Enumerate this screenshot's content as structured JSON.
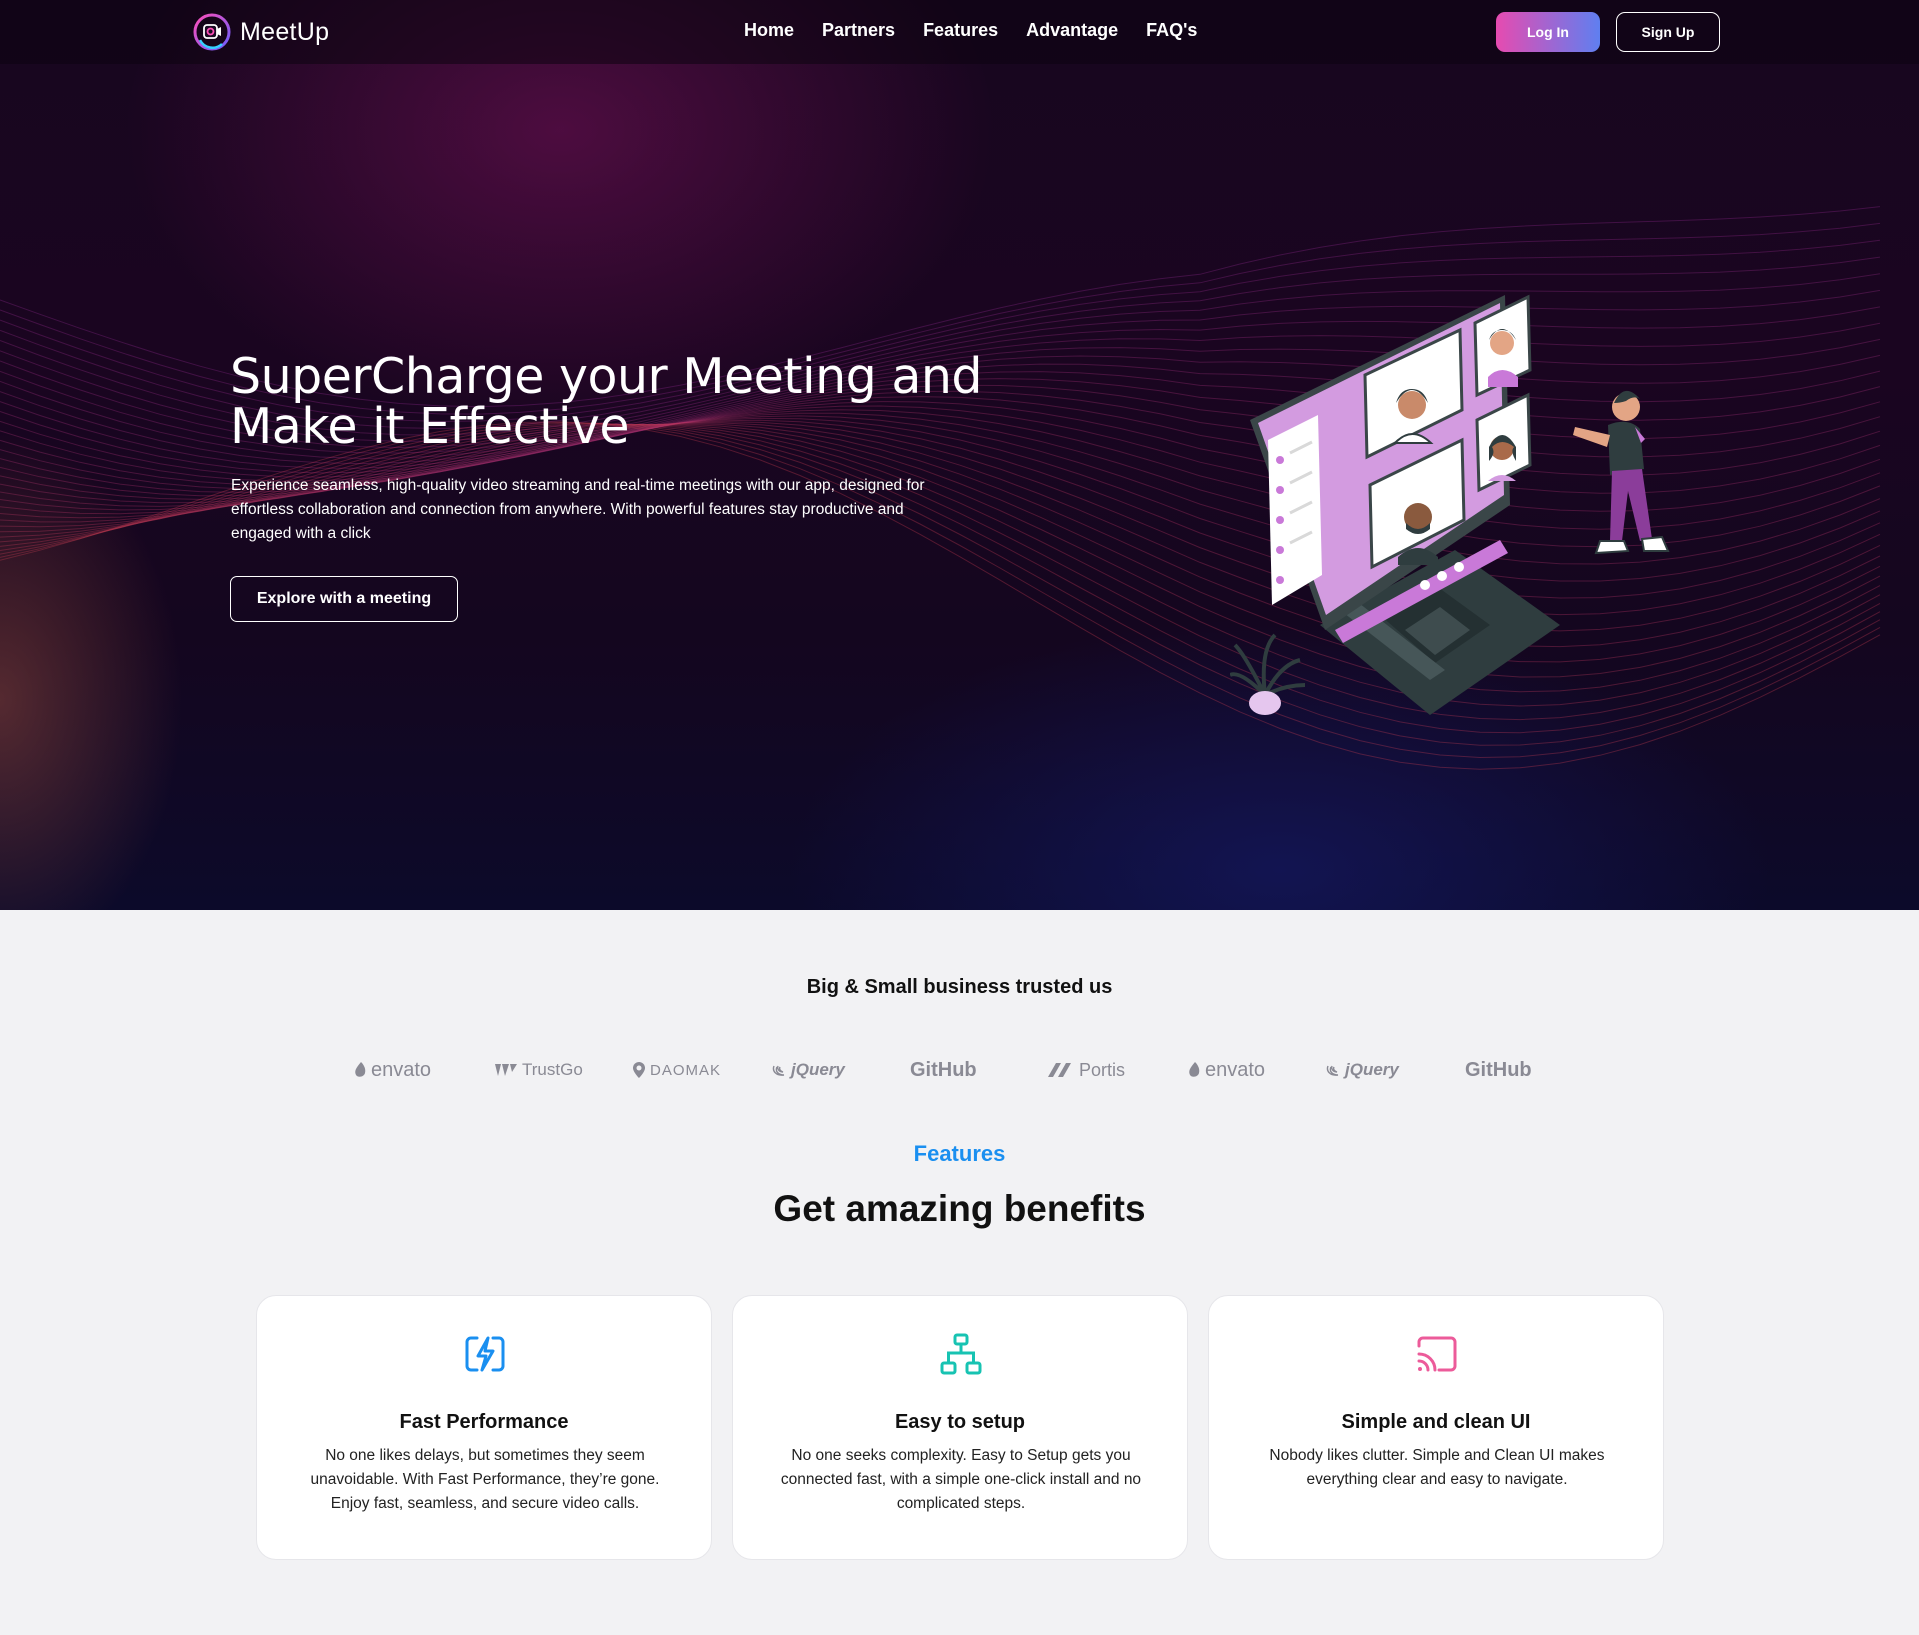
{
  "header": {
    "brand": "MeetUp",
    "nav": [
      {
        "label": "Home"
      },
      {
        "label": "Partners"
      },
      {
        "label": "Features"
      },
      {
        "label": "Advantage"
      },
      {
        "label": "FAQ's"
      }
    ],
    "login_label": "Log In",
    "signup_label": "Sign Up"
  },
  "hero": {
    "title": "SuperCharge your Meeting and Make it Effective",
    "description": "Experience seamless, high-quality video streaming and real-time meetings with our app, designed for effortless collaboration and connection from anywhere. With powerful features stay productive and engaged with a click",
    "cta_label": "Explore with a meeting"
  },
  "trusted": {
    "title": "Big & Small business trusted us",
    "brands": [
      {
        "name": "envato",
        "icon": "envato-leaf-icon"
      },
      {
        "name": "TrustGo",
        "icon": "trustgo-icon"
      },
      {
        "name": "DAOMAK",
        "icon": "map-pin-icon"
      },
      {
        "name": "jQuery",
        "icon": "jquery-icon"
      },
      {
        "name": "GitHub",
        "icon": ""
      },
      {
        "name": "Portis",
        "icon": "portis-icon"
      },
      {
        "name": "envato",
        "icon": "envato-leaf-icon"
      },
      {
        "name": "jQuery",
        "icon": "jquery-icon"
      },
      {
        "name": "GitHub",
        "icon": ""
      }
    ]
  },
  "features": {
    "eyebrow": "Features",
    "heading": "Get amazing benefits",
    "cards": [
      {
        "title": "Fast Performance",
        "description": "No one likes delays, but sometimes they seem unavoidable. With Fast Performance, they’re gone. Enjoy fast, seamless, and secure video calls.",
        "icon": "lightning-icon",
        "color": "#1a8ff0"
      },
      {
        "title": "Easy to setup",
        "description": "No one seeks complexity. Easy to Setup gets you connected fast, with a simple one-click install and no complicated steps.",
        "icon": "sitemap-icon",
        "color": "#17c3b2"
      },
      {
        "title": "Simple and clean UI",
        "description": "Nobody likes clutter. Simple and Clean UI makes everything clear and easy to navigate.",
        "icon": "cast-icon",
        "color": "#ec5b9a"
      }
    ]
  },
  "colors": {
    "accent_blue": "#1a8ff0",
    "login_gradient_start": "#e64bb0",
    "login_gradient_end": "#5f7ff0",
    "hero_bg": "#18061f",
    "page_bg": "#f2f2f4"
  }
}
